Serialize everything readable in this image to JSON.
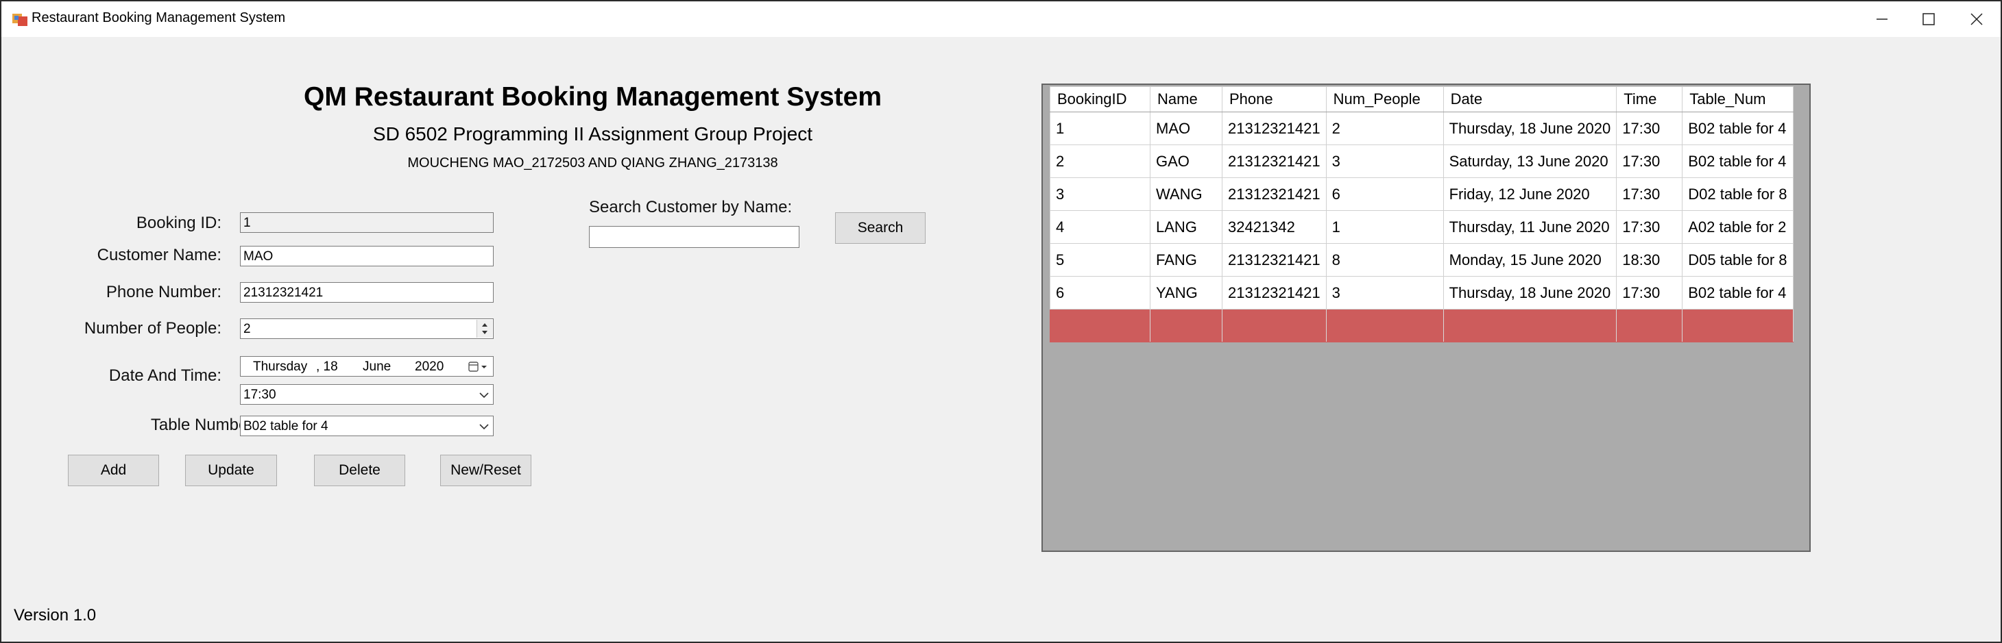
{
  "window": {
    "title": "Restaurant Booking Management System"
  },
  "header": {
    "title": "QM Restaurant Booking Management System",
    "subtitle": "SD 6502 Programming II Assignment Group Project",
    "authors": "MOUCHENG MAO_2172503 AND QIANG ZHANG_2173138"
  },
  "form": {
    "booking_id_label": "Booking ID:",
    "booking_id_value": "1",
    "customer_name_label": "Customer Name:",
    "customer_name_value": "MAO",
    "phone_label": "Phone Number:",
    "phone_value": "21312321421",
    "people_label": "Number of People:",
    "people_value": "2",
    "datetime_label": "Date And Time:",
    "date_weekday": "Thursday",
    "date_day": ", 18",
    "date_month": "June",
    "date_year": "2020",
    "time_value": "17:30",
    "table_label": "Table Number:",
    "table_value": "B02 table for 4"
  },
  "buttons": {
    "add": "Add",
    "update": "Update",
    "delete": "Delete",
    "reset": "New/Reset"
  },
  "search": {
    "label": "Search Customer by Name:",
    "value": "",
    "button": "Search"
  },
  "grid": {
    "headers": [
      "BookingID",
      "Name",
      "Phone",
      "Num_People",
      "Date",
      "Time",
      "Table_Num"
    ],
    "rows": [
      [
        "1",
        "MAO",
        "21312321421",
        "2",
        "Thursday, 18 June 2020",
        "17:30",
        "B02 table for 4"
      ],
      [
        "2",
        "GAO",
        "21312321421",
        "3",
        "Saturday, 13 June 2020",
        "17:30",
        "B02 table for 4"
      ],
      [
        "3",
        "WANG",
        "21312321421",
        "6",
        "Friday, 12 June 2020",
        "17:30",
        "D02 table for 8"
      ],
      [
        "4",
        "LANG",
        "32421342",
        "1",
        "Thursday, 11 June 2020",
        "17:30",
        "A02 table for 2"
      ],
      [
        "5",
        "FANG",
        "21312321421",
        "8",
        "Monday, 15 June 2020",
        "18:30",
        "D05 table for 8"
      ],
      [
        "6",
        "YANG",
        "21312321421",
        "3",
        "Thursday, 18 June 2020",
        "17:30",
        "B02 table for 4"
      ]
    ],
    "new_row_color": "#cd5c5c"
  },
  "footer": {
    "version": "Version 1.0"
  }
}
